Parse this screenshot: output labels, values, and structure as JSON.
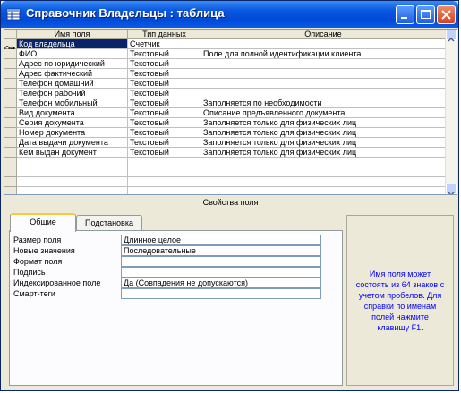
{
  "window": {
    "title": "Справочник Владельцы : таблица"
  },
  "grid": {
    "headers": [
      "Имя поля",
      "Тип данных",
      "Описание"
    ],
    "rows": [
      {
        "name": "Код владельца",
        "type": "Счетчик",
        "desc": "",
        "key": true
      },
      {
        "name": "ФИО",
        "type": "Текстовый",
        "desc": "Поле для полной идентификации клиента"
      },
      {
        "name": "Адрес по юридический",
        "type": "Текстовый",
        "desc": ""
      },
      {
        "name": "Адрес фактический",
        "type": "Текстовый",
        "desc": ""
      },
      {
        "name": "Телефон домашний",
        "type": "Текстовый",
        "desc": ""
      },
      {
        "name": "Телефон рабочий",
        "type": "Текстовый",
        "desc": ""
      },
      {
        "name": "Телефон мобильный",
        "type": "Текстовый",
        "desc": "Заполняется по необходимости"
      },
      {
        "name": "Вид документа",
        "type": "Текстовый",
        "desc": "Описание предъявленного документа"
      },
      {
        "name": "Серия документа",
        "type": "Текстовый",
        "desc": "Заполняется только для физических лиц"
      },
      {
        "name": "Номер документа",
        "type": "Текстовый",
        "desc": "Заполняется только для физических лиц"
      },
      {
        "name": "Дата выдачи документа",
        "type": "Текстовый",
        "desc": "Заполняется только для физических лиц"
      },
      {
        "name": "Кем выдан документ",
        "type": "Текстовый",
        "desc": "Заполняется только для физических лиц"
      }
    ],
    "empty_rows": 4
  },
  "properties": {
    "title": "Свойства поля",
    "tabs": [
      "Общие",
      "Подстановка"
    ],
    "items": [
      {
        "label": "Размер поля",
        "value": "Длинное целое"
      },
      {
        "label": "Новые значения",
        "value": "Последовательные"
      },
      {
        "label": "Формат поля",
        "value": ""
      },
      {
        "label": "Подпись",
        "value": ""
      },
      {
        "label": "Индексированное поле",
        "value": "Да (Совпадения не допускаются)"
      },
      {
        "label": "Смарт-теги",
        "value": ""
      }
    ],
    "help_text": "Имя поля может состоять из 64 знаков с учетом пробелов.  Для справки по именам полей нажмите клавишу F1."
  }
}
